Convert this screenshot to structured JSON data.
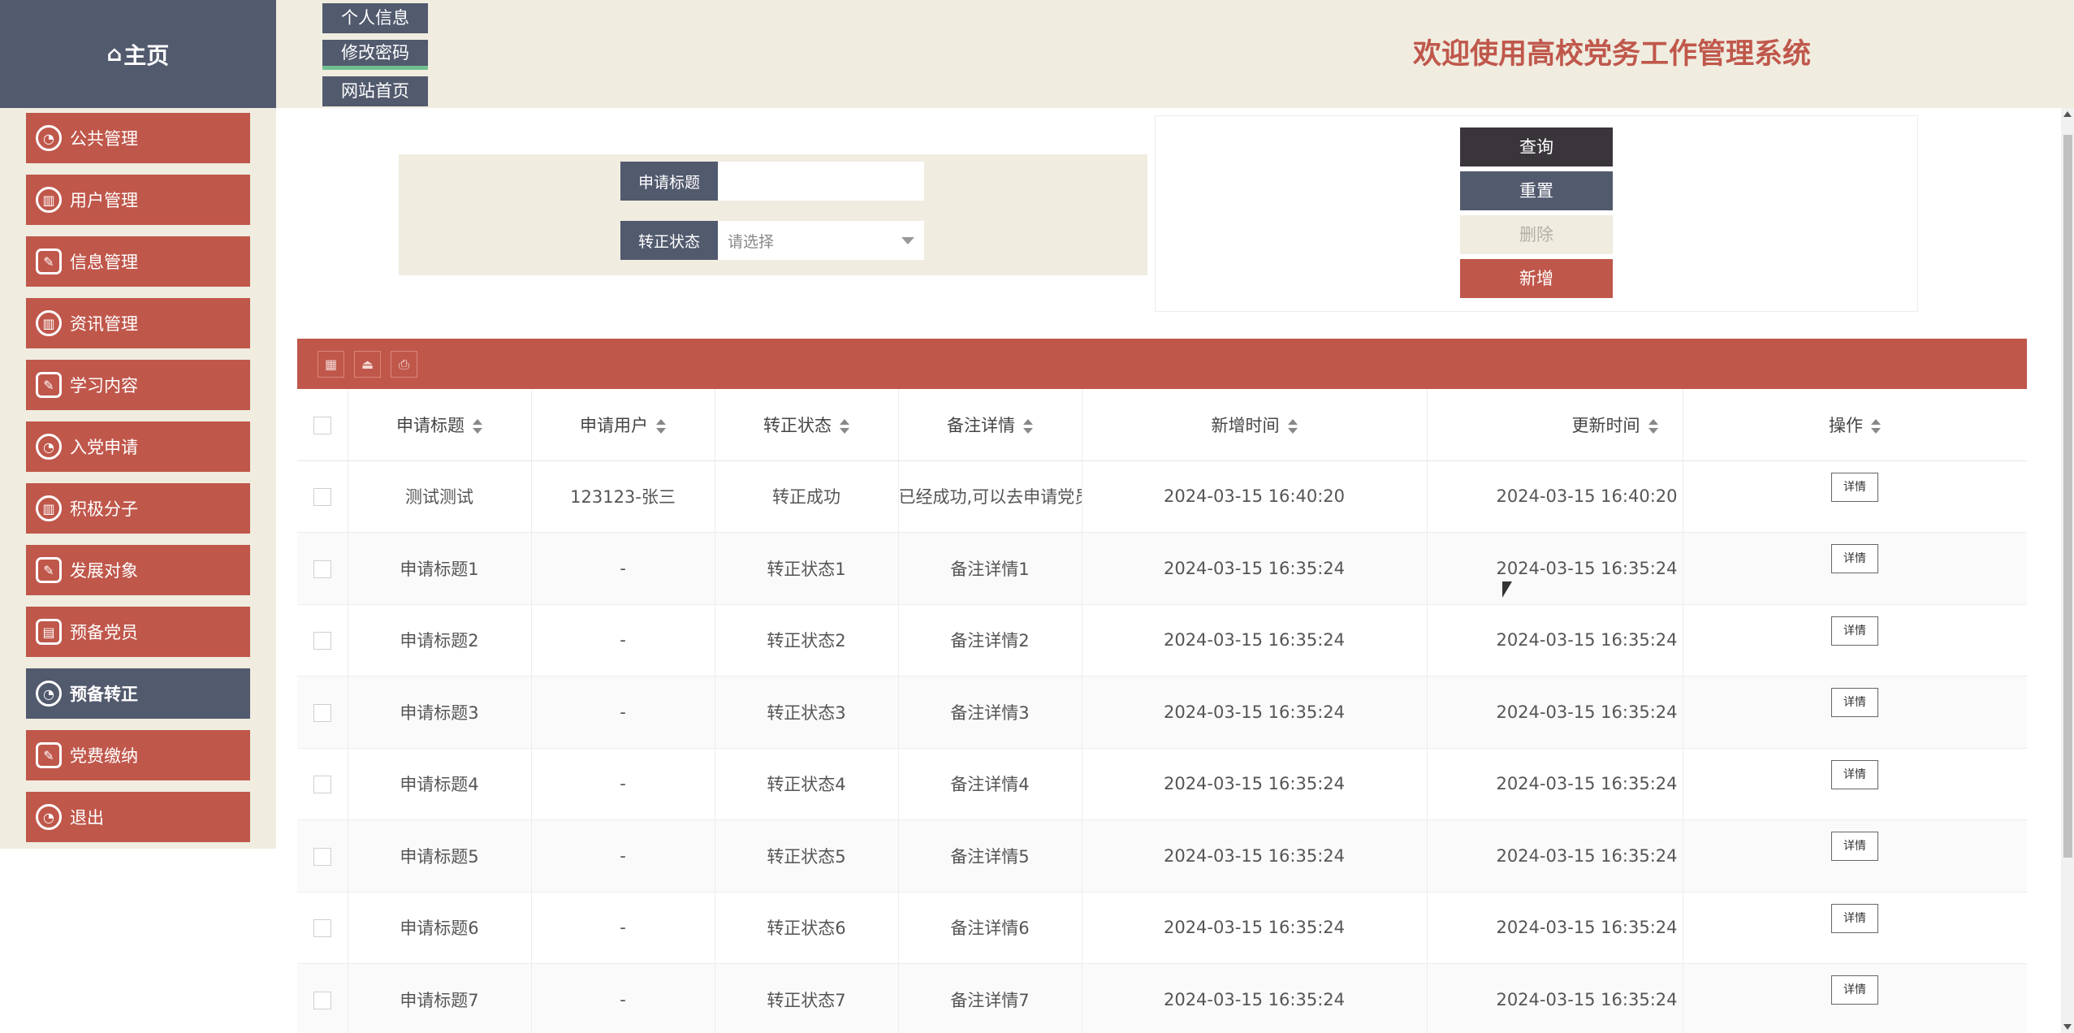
{
  "header": {
    "home_label": "主页",
    "buttons": [
      "个人信息",
      "修改密码",
      "网站首页"
    ],
    "active_button_index": 1,
    "site_title": "欢迎使用高校党务工作管理系统"
  },
  "sidebar": {
    "items": [
      {
        "label": "公共管理",
        "icon": "dashboard-icon"
      },
      {
        "label": "用户管理",
        "icon": "bar-chart-icon"
      },
      {
        "label": "信息管理",
        "icon": "edit-icon"
      },
      {
        "label": "资讯管理",
        "icon": "bar-chart-icon"
      },
      {
        "label": "学习内容",
        "icon": "edit-icon"
      },
      {
        "label": "入党申请",
        "icon": "dashboard-icon"
      },
      {
        "label": "积极分子",
        "icon": "bar-chart-icon"
      },
      {
        "label": "发展对象",
        "icon": "edit-icon"
      },
      {
        "label": "预备党员",
        "icon": "clipboard-icon"
      },
      {
        "label": "预备转正",
        "icon": "dashboard-icon"
      },
      {
        "label": "党费缴纳",
        "icon": "edit-icon"
      },
      {
        "label": "退出",
        "icon": "dashboard-icon"
      }
    ],
    "active_index": 9
  },
  "search": {
    "title_label": "申请标题",
    "title_value": "",
    "status_label": "转正状态",
    "status_placeholder": "请选择"
  },
  "actions": {
    "query": "查询",
    "reset": "重置",
    "delete": "删除",
    "add": "新增"
  },
  "colors": {
    "primary_red": "#c0574b",
    "slate": "#525a6e",
    "dark": "#3a353b",
    "beige": "#f0ece0"
  },
  "table": {
    "columns": [
      "申请标题",
      "申请用户",
      "转正状态",
      "备注详情",
      "新增时间",
      "更新时间",
      "操作"
    ],
    "detail_label": "详情",
    "rows": [
      [
        "测试测试",
        "123123-张三",
        "转正成功",
        "已经成功,可以去申请党员",
        "2024-03-15 16:40:20",
        "2024-03-15 16:40:20"
      ],
      [
        "申请标题1",
        "-",
        "转正状态1",
        "备注详情1",
        "2024-03-15 16:35:24",
        "2024-03-15 16:35:24"
      ],
      [
        "申请标题2",
        "-",
        "转正状态2",
        "备注详情2",
        "2024-03-15 16:35:24",
        "2024-03-15 16:35:24"
      ],
      [
        "申请标题3",
        "-",
        "转正状态3",
        "备注详情3",
        "2024-03-15 16:35:24",
        "2024-03-15 16:35:24"
      ],
      [
        "申请标题4",
        "-",
        "转正状态4",
        "备注详情4",
        "2024-03-15 16:35:24",
        "2024-03-15 16:35:24"
      ],
      [
        "申请标题5",
        "-",
        "转正状态5",
        "备注详情5",
        "2024-03-15 16:35:24",
        "2024-03-15 16:35:24"
      ],
      [
        "申请标题6",
        "-",
        "转正状态6",
        "备注详情6",
        "2024-03-15 16:35:24",
        "2024-03-15 16:35:24"
      ],
      [
        "申请标题7",
        "-",
        "转正状态7",
        "备注详情7",
        "2024-03-15 16:35:24",
        "2024-03-15 16:35:24"
      ]
    ]
  }
}
